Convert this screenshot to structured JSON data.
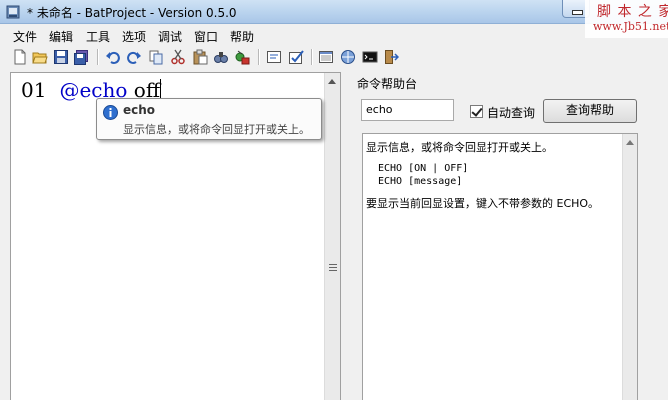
{
  "window": {
    "title": "* 未命名 - BatProject - Version 0.5.0",
    "watermark_line1": "脚 本 之 家",
    "watermark_line2": "www.Jb51.net"
  },
  "menu": [
    {
      "label": "文件"
    },
    {
      "label": "编辑"
    },
    {
      "label": "工具"
    },
    {
      "label": "选项"
    },
    {
      "label": "调试"
    },
    {
      "label": "窗口"
    },
    {
      "label": "帮助"
    }
  ],
  "toolbar": {
    "icons": [
      "new-file-icon",
      "open-folder-icon",
      "save-icon",
      "save-all-icon",
      "undo-icon",
      "redo-icon",
      "copy-icon",
      "cut-icon",
      "paste-icon",
      "find-icon",
      "replace-icon",
      "run-icon",
      "check-icon",
      "console-icon",
      "window-icon",
      "cmd-icon",
      "exit-icon"
    ]
  },
  "editor": {
    "line_number": "01",
    "keyword": "@echo",
    "argument": " off",
    "autocomplete": {
      "title": "echo",
      "description": "显示信息，或将命令回显打开或关上。"
    }
  },
  "help": {
    "panel_title": "命令帮助台",
    "input_value": "echo",
    "auto_query_label": "自动查询",
    "auto_query_checked": true,
    "query_button": "查询帮助",
    "content": {
      "description": "显示信息，或将命令回显打开或关上。",
      "syntax_1": "ECHO [ON | OFF]",
      "syntax_2": "ECHO [message]",
      "note": "要显示当前回显设置，键入不带参数的 ECHO。"
    }
  },
  "colors": {
    "keyword": "#0000c8",
    "title_bar": "#b9d3ee",
    "watermark": "#c0282d"
  }
}
